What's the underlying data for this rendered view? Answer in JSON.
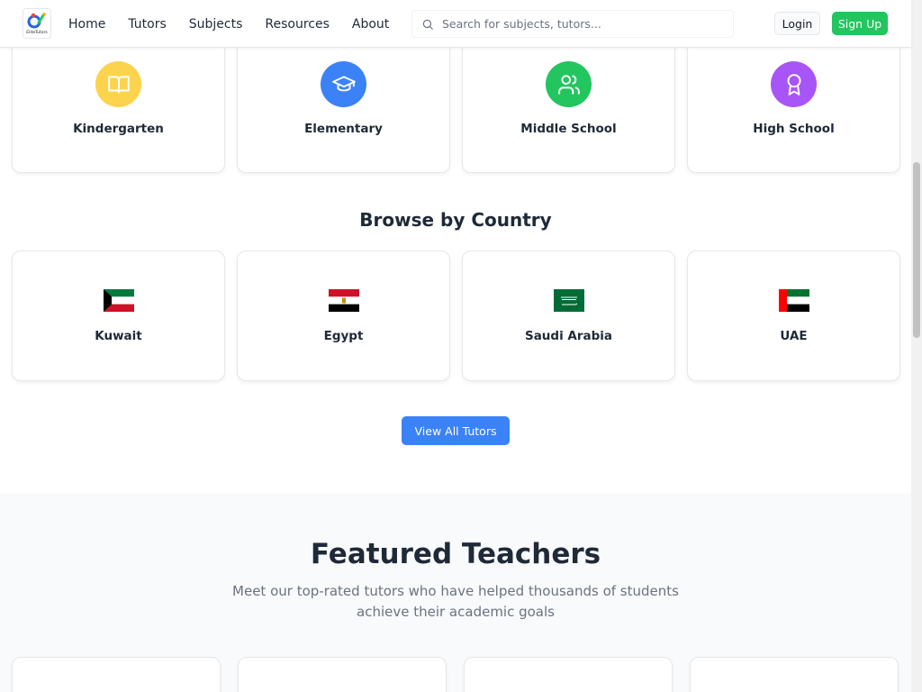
{
  "header": {
    "logo_text": "EliteTutors",
    "nav": [
      "Home",
      "Tutors",
      "Subjects",
      "Resources",
      "About"
    ],
    "search_placeholder": "Search for subjects, tutors...",
    "login_label": "Login",
    "signup_label": "Sign Up"
  },
  "levels": [
    {
      "label": "Kindergarten",
      "icon": "book-open-icon",
      "color": "#fcd34d"
    },
    {
      "label": "Elementary",
      "icon": "graduation-cap-icon",
      "color": "#3b82f6"
    },
    {
      "label": "Middle School",
      "icon": "users-icon",
      "color": "#22c55e"
    },
    {
      "label": "High School",
      "icon": "award-icon",
      "color": "#a855f7"
    }
  ],
  "countries_section": {
    "title": "Browse by Country",
    "countries": [
      {
        "label": "Kuwait",
        "flag": "kuwait-flag-icon"
      },
      {
        "label": "Egypt",
        "flag": "egypt-flag-icon"
      },
      {
        "label": "Saudi Arabia",
        "flag": "saudi-arabia-flag-icon"
      },
      {
        "label": "UAE",
        "flag": "uae-flag-icon"
      }
    ]
  },
  "view_all_label": "View All Tutors",
  "featured": {
    "title": "Featured Teachers",
    "subtitle": "Meet our top-rated tutors who have helped thousands of students achieve their academic goals"
  },
  "colors": {
    "primary": "#3b82f6",
    "success": "#22c55e",
    "section_bg": "#f9fafb"
  }
}
